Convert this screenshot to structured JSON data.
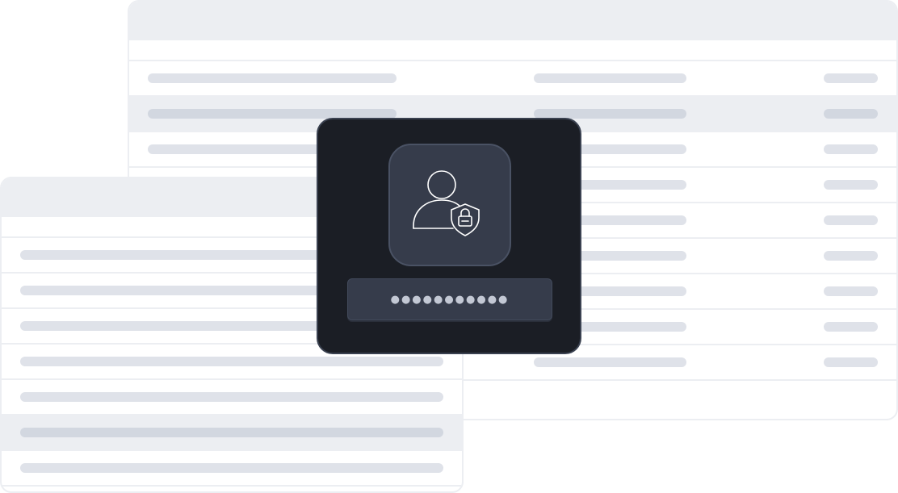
{
  "tables": {
    "back": {
      "rows": 9,
      "highlighted_row": 1
    },
    "front": {
      "rows": 7,
      "highlighted_row": 5
    }
  },
  "login": {
    "icon": "user-shield-lock-icon",
    "password_masked": "●●●●●●●●●●●"
  },
  "colors": {
    "card_bg": "#1b1e25",
    "tile_bg": "#363c4b",
    "table_header": "#eceef2",
    "placeholder_bar": "#dfe2e9"
  }
}
